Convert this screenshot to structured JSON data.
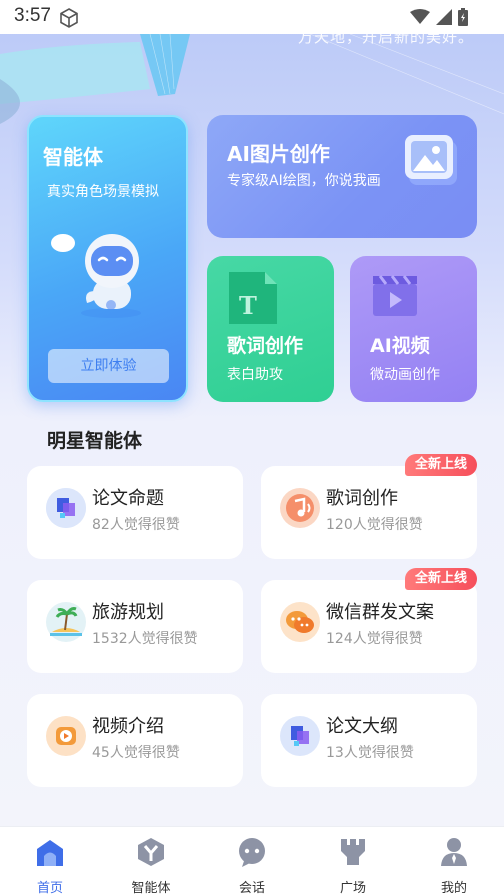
{
  "status_bar": {
    "time": "3:57"
  },
  "hero": {
    "slogan": "万天地，开启新的美好。"
  },
  "cards": {
    "agent": {
      "title": "智能体",
      "subtitle": "真实角色场景模拟",
      "button": "立即体验"
    },
    "image": {
      "title": "AI图片创作",
      "subtitle": "专家级AI绘图，你说我画"
    },
    "lyric": {
      "title": "歌词创作",
      "subtitle": "表白助攻"
    },
    "video": {
      "title": "AI视频",
      "subtitle": "微动画创作"
    }
  },
  "section": {
    "title": "明星智能体"
  },
  "stars": [
    {
      "name": "论文命题",
      "likes": "82人觉得很赞",
      "icon": "paper-icon",
      "badge": ""
    },
    {
      "name": "歌词创作",
      "likes": "120人觉得很赞",
      "icon": "music-icon",
      "badge": "全新上线"
    },
    {
      "name": "旅游规划",
      "likes": "1532人觉得很赞",
      "icon": "island-icon",
      "badge": ""
    },
    {
      "name": "微信群发文案",
      "likes": "124人觉得很赞",
      "icon": "chat-icon",
      "badge": "全新上线"
    },
    {
      "name": "视频介绍",
      "likes": "45人觉得很赞",
      "icon": "video-icon",
      "badge": ""
    },
    {
      "name": "论文大纲",
      "likes": "13人觉得很赞",
      "icon": "paper-icon",
      "badge": ""
    }
  ],
  "nav": [
    {
      "label": "首页",
      "icon": "home-icon",
      "active": true
    },
    {
      "label": "智能体",
      "icon": "agent-icon",
      "active": false
    },
    {
      "label": "会话",
      "icon": "chat-icon",
      "active": false
    },
    {
      "label": "广场",
      "icon": "plaza-icon",
      "active": false
    },
    {
      "label": "我的",
      "icon": "profile-icon",
      "active": false
    }
  ],
  "colors": {
    "accent": "#3f6ee8",
    "badge": "#f64f5b",
    "lyric_card": "#2fcf93",
    "video_card": "#9481f3"
  }
}
